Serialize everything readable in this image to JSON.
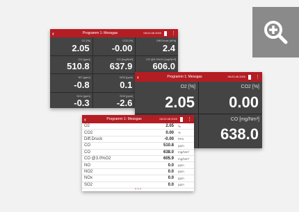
{
  "screen1": {
    "title": "Programm 1: Messgas",
    "clock": "08:22:48\n2020",
    "cells": [
      {
        "label": "O2  [%]",
        "value": "2.05"
      },
      {
        "label": "CO2  [%]",
        "value": "-0.00"
      },
      {
        "label": "Diff.Druck  [hPa]",
        "value": "2.4"
      },
      {
        "label": "CO  [ppm]",
        "value": "510.8"
      },
      {
        "label": "CO  [mg/Nm³]",
        "value": "637.9"
      },
      {
        "label": "CO @3.0%O2 [mg/Nm³]",
        "value": "606.0"
      },
      {
        "label": "NO  [ppm]",
        "value": "-0.8"
      },
      {
        "label": "NO2  [ppm]",
        "value": "0.1"
      },
      {
        "label": "",
        "value": ""
      },
      {
        "label": "NOx  [ppm]",
        "value": "-0.3"
      },
      {
        "label": "SO2  [ppm]",
        "value": "-2.6"
      },
      {
        "label": "",
        "value": ""
      }
    ]
  },
  "screen2": {
    "title": "Programm 1: Messgas",
    "clock": "08:22:48\n2020",
    "cells": [
      {
        "label": "O2  [%]",
        "value": "2.05"
      },
      {
        "label": "CO2  [%]",
        "value": "0.00"
      },
      {
        "label": "",
        "value": ""
      },
      {
        "label": "CO  [mg/Nm³]",
        "value": "638.0"
      }
    ]
  },
  "screen3": {
    "title": "Programm 1: Messgas",
    "clock": "08:22:48\n2020",
    "rows": [
      {
        "name": "O2",
        "value": "2.05",
        "unit": "%"
      },
      {
        "name": "CO2",
        "value": "0.00",
        "unit": "%"
      },
      {
        "name": "Diff.Druck",
        "value": "-0.00",
        "unit": "hPa"
      },
      {
        "name": "CO",
        "value": "510.8",
        "unit": "ppm"
      },
      {
        "name": "CO",
        "value": "638.0",
        "unit": "mg/Nm³"
      },
      {
        "name": "CO @3.0%O2",
        "value": "605.9",
        "unit": "mg/Nm³"
      },
      {
        "name": "NO",
        "value": "0.0",
        "unit": "ppm"
      },
      {
        "name": "NO2",
        "value": "0.0",
        "unit": "ppm"
      },
      {
        "name": "NOx",
        "value": "0.0",
        "unit": "ppm"
      },
      {
        "name": "SO2",
        "value": "0.0",
        "unit": "ppm"
      }
    ],
    "footer": "≡ ≡ ≡"
  },
  "zoom": {
    "icon": "zoom-in-icon",
    "color": "#8a8a8a"
  },
  "colors": {
    "accent": "#b31d23",
    "dark_panel": "#444444"
  }
}
